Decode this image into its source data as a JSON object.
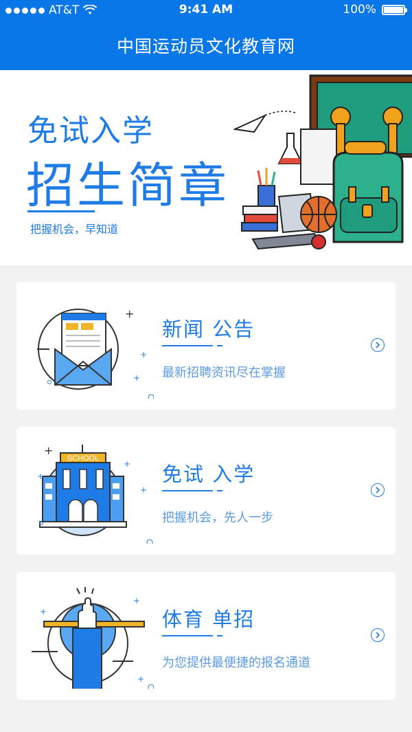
{
  "status_bar": {
    "carrier": "AT&T",
    "time": "9:41 AM",
    "battery": "100%"
  },
  "header": {
    "title": "中国运动员文化教育网"
  },
  "banner": {
    "subtitle": "免试入学",
    "title": "招生简章",
    "tagline": "把握机会，早知道"
  },
  "cards": [
    {
      "title": "新闻  公告",
      "desc": "最新招聘资讯尽在掌握",
      "icon": "envelope-icon"
    },
    {
      "title": "免试  入学",
      "desc": "把握机会，先人一步",
      "icon": "school-building-icon",
      "illus_label": "SCHOOL"
    },
    {
      "title": "体育  单招",
      "desc": "为您提供最便捷的报名通道",
      "icon": "raised-hand-icon"
    }
  ],
  "colors": {
    "primary": "#0a77e8",
    "accent": "#1f7be6",
    "background": "#f2f2f2"
  }
}
